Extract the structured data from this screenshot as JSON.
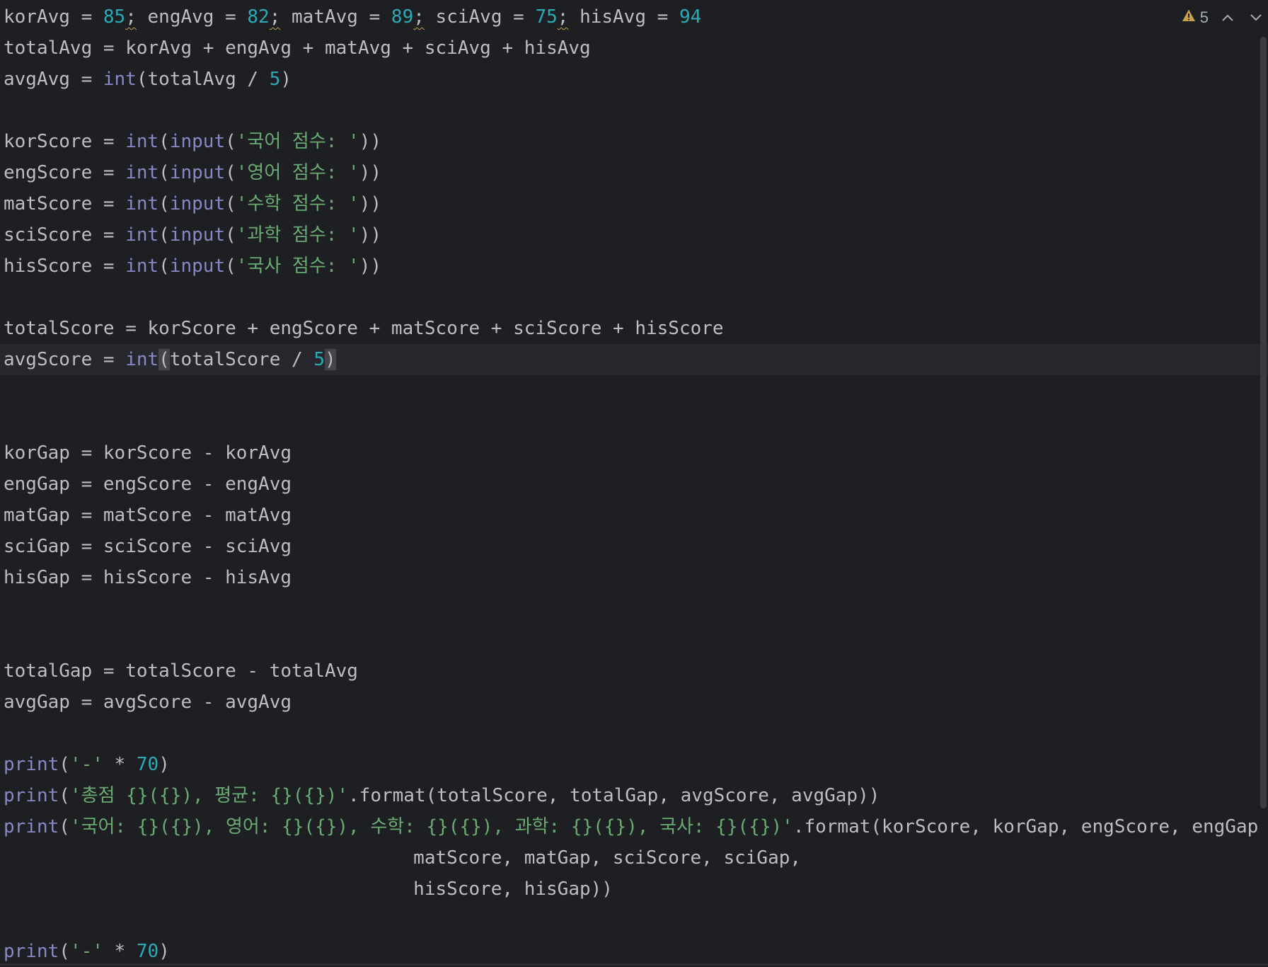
{
  "editor": {
    "lines": [
      [
        [
          "var",
          "korAvg"
        ],
        [
          "op",
          " = "
        ],
        [
          "num",
          "85"
        ],
        [
          "op",
          ";",
          "squiggle"
        ],
        [
          "op",
          " "
        ],
        [
          "var",
          "engAvg"
        ],
        [
          "op",
          " = "
        ],
        [
          "num",
          "82"
        ],
        [
          "op",
          ";",
          "squiggle"
        ],
        [
          "op",
          " "
        ],
        [
          "var",
          "matAvg"
        ],
        [
          "op",
          " = "
        ],
        [
          "num",
          "89"
        ],
        [
          "op",
          ";",
          "squiggle"
        ],
        [
          "op",
          " "
        ],
        [
          "var",
          "sciAvg"
        ],
        [
          "op",
          " = "
        ],
        [
          "num",
          "75"
        ],
        [
          "op",
          ";",
          "squiggle"
        ],
        [
          "op",
          " "
        ],
        [
          "var",
          "hisAvg"
        ],
        [
          "op",
          " = "
        ],
        [
          "num",
          "94"
        ]
      ],
      [
        [
          "var",
          "totalAvg"
        ],
        [
          "op",
          " = "
        ],
        [
          "var",
          "korAvg"
        ],
        [
          "op",
          " + "
        ],
        [
          "var",
          "engAvg"
        ],
        [
          "op",
          " + "
        ],
        [
          "var",
          "matAvg"
        ],
        [
          "op",
          " + "
        ],
        [
          "var",
          "sciAvg"
        ],
        [
          "op",
          " + "
        ],
        [
          "var",
          "hisAvg"
        ]
      ],
      [
        [
          "var",
          "avgAvg"
        ],
        [
          "op",
          " = "
        ],
        [
          "builtin",
          "int"
        ],
        [
          "op",
          "("
        ],
        [
          "var",
          "totalAvg"
        ],
        [
          "op",
          " / "
        ],
        [
          "num",
          "5"
        ],
        [
          "op",
          ")"
        ]
      ],
      [],
      [
        [
          "var",
          "korScore"
        ],
        [
          "op",
          " = "
        ],
        [
          "builtin",
          "int"
        ],
        [
          "op",
          "("
        ],
        [
          "builtin",
          "input"
        ],
        [
          "op",
          "("
        ],
        [
          "str",
          "'국어 점수: '"
        ],
        [
          "op",
          "))"
        ]
      ],
      [
        [
          "var",
          "engScore"
        ],
        [
          "op",
          " = "
        ],
        [
          "builtin",
          "int"
        ],
        [
          "op",
          "("
        ],
        [
          "builtin",
          "input"
        ],
        [
          "op",
          "("
        ],
        [
          "str",
          "'영어 점수: '"
        ],
        [
          "op",
          "))"
        ]
      ],
      [
        [
          "var",
          "matScore"
        ],
        [
          "op",
          " = "
        ],
        [
          "builtin",
          "int"
        ],
        [
          "op",
          "("
        ],
        [
          "builtin",
          "input"
        ],
        [
          "op",
          "("
        ],
        [
          "str",
          "'수학 점수: '"
        ],
        [
          "op",
          "))"
        ]
      ],
      [
        [
          "var",
          "sciScore"
        ],
        [
          "op",
          " = "
        ],
        [
          "builtin",
          "int"
        ],
        [
          "op",
          "("
        ],
        [
          "builtin",
          "input"
        ],
        [
          "op",
          "("
        ],
        [
          "str",
          "'과학 점수: '"
        ],
        [
          "op",
          "))"
        ]
      ],
      [
        [
          "var",
          "hisScore"
        ],
        [
          "op",
          " = "
        ],
        [
          "builtin",
          "int"
        ],
        [
          "op",
          "("
        ],
        [
          "builtin",
          "input"
        ],
        [
          "op",
          "("
        ],
        [
          "str",
          "'국사 점수: '"
        ],
        [
          "op",
          "))"
        ]
      ],
      [],
      [
        [
          "var",
          "totalScore"
        ],
        [
          "op",
          " = "
        ],
        [
          "var",
          "korScore"
        ],
        [
          "op",
          " + "
        ],
        [
          "var",
          "engScore"
        ],
        [
          "op",
          " + "
        ],
        [
          "var",
          "matScore"
        ],
        [
          "op",
          " + "
        ],
        [
          "var",
          "sciScore"
        ],
        [
          "op",
          " + "
        ],
        [
          "var",
          "hisScore"
        ]
      ],
      [
        [
          "var",
          "avgScore"
        ],
        [
          "op",
          " = "
        ],
        [
          "builtin",
          "int"
        ],
        [
          "op",
          "(",
          "brace"
        ],
        [
          "var",
          "totalScore"
        ],
        [
          "op",
          " / "
        ],
        [
          "num",
          "5"
        ],
        [
          "op",
          ")",
          "brace"
        ]
      ],
      [],
      [],
      [
        [
          "var",
          "korGap"
        ],
        [
          "op",
          " = "
        ],
        [
          "var",
          "korScore"
        ],
        [
          "op",
          " - "
        ],
        [
          "var",
          "korAvg"
        ]
      ],
      [
        [
          "var",
          "engGap"
        ],
        [
          "op",
          " = "
        ],
        [
          "var",
          "engScore"
        ],
        [
          "op",
          " - "
        ],
        [
          "var",
          "engAvg"
        ]
      ],
      [
        [
          "var",
          "matGap"
        ],
        [
          "op",
          " = "
        ],
        [
          "var",
          "matScore"
        ],
        [
          "op",
          " - "
        ],
        [
          "var",
          "matAvg"
        ]
      ],
      [
        [
          "var",
          "sciGap"
        ],
        [
          "op",
          " = "
        ],
        [
          "var",
          "sciScore"
        ],
        [
          "op",
          " - "
        ],
        [
          "var",
          "sciAvg"
        ]
      ],
      [
        [
          "var",
          "hisGap"
        ],
        [
          "op",
          " = "
        ],
        [
          "var",
          "hisScore"
        ],
        [
          "op",
          " - "
        ],
        [
          "var",
          "hisAvg"
        ]
      ],
      [],
      [],
      [
        [
          "var",
          "totalGap"
        ],
        [
          "op",
          " = "
        ],
        [
          "var",
          "totalScore"
        ],
        [
          "op",
          " - "
        ],
        [
          "var",
          "totalAvg"
        ]
      ],
      [
        [
          "var",
          "avgGap"
        ],
        [
          "op",
          " = "
        ],
        [
          "var",
          "avgScore"
        ],
        [
          "op",
          " - "
        ],
        [
          "var",
          "avgAvg"
        ]
      ],
      [],
      [
        [
          "builtin",
          "print"
        ],
        [
          "op",
          "("
        ],
        [
          "str",
          "'-'"
        ],
        [
          "op",
          " * "
        ],
        [
          "num",
          "70"
        ],
        [
          "op",
          ")"
        ]
      ],
      [
        [
          "builtin",
          "print"
        ],
        [
          "op",
          "("
        ],
        [
          "str",
          "'총점 {}({}), 평균: {}({})'"
        ],
        [
          "op",
          ".format(totalScore, totalGap, avgScore, avgGap))"
        ]
      ],
      [
        [
          "builtin",
          "print"
        ],
        [
          "op",
          "("
        ],
        [
          "str",
          "'국어: {}({}), 영어: {}({}), 수학: {}({}), 과학: {}({}), 국사: {}({})'"
        ],
        [
          "op",
          ".format(korScore, korGap, engScore, engGap"
        ]
      ],
      [
        [
          "op",
          "                                     matScore, matGap, sciScore, sciGap,"
        ]
      ],
      [
        [
          "op",
          "                                     hisScore, hisGap))"
        ]
      ],
      [],
      [
        [
          "builtin",
          "print"
        ],
        [
          "op",
          "("
        ],
        [
          "str",
          "'-'"
        ],
        [
          "op",
          " * "
        ],
        [
          "num",
          "70"
        ],
        [
          "op",
          ")"
        ]
      ]
    ],
    "current_line_index": 11
  },
  "inspection_widget": {
    "warning_count": "5",
    "warning_icon": "warning-triangle-icon",
    "prev_icon": "chevron-up-icon",
    "next_icon": "chevron-down-icon",
    "warning_color": "#c9a24b"
  }
}
